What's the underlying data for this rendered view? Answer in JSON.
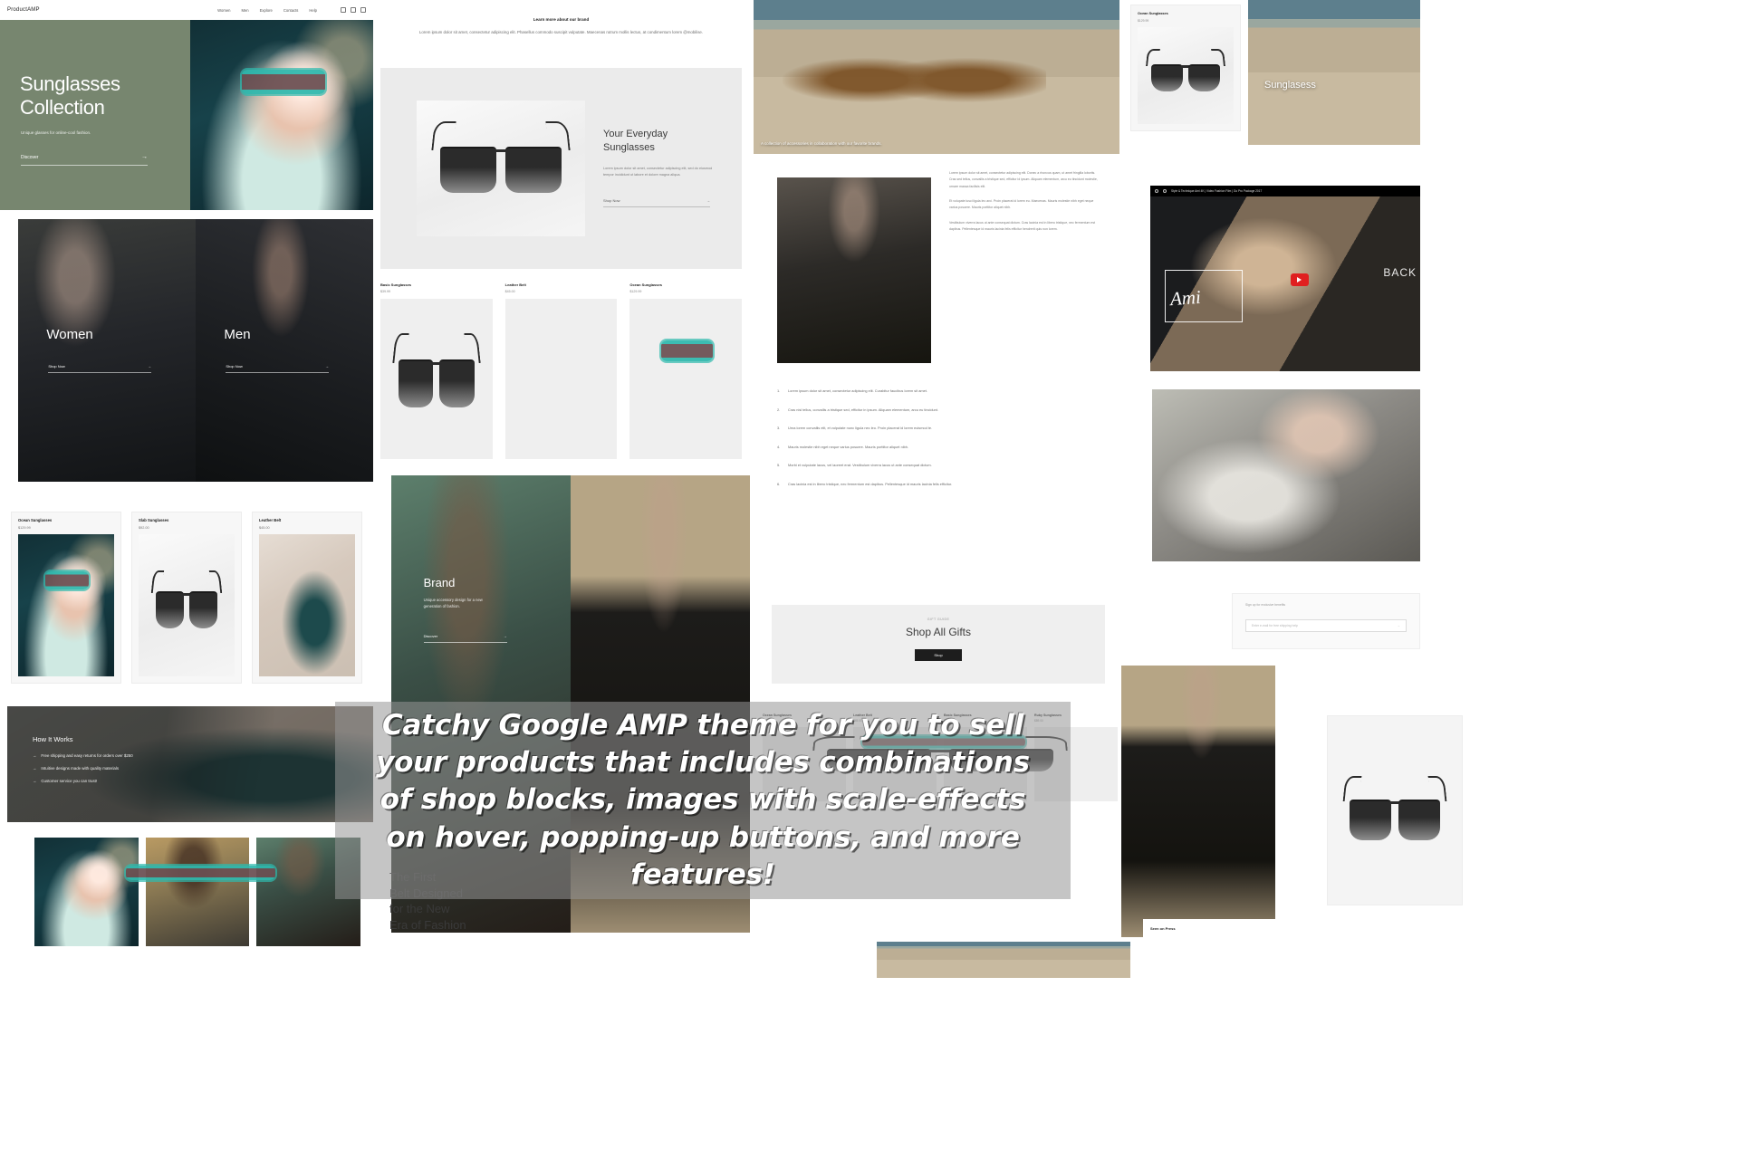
{
  "caption": {
    "text": "Catchy Google AMP theme for you to sell your products that includes combinations of shop blocks, images with scale-effects on hover, popping-up buttons, and more features!"
  },
  "hero": {
    "logo": "ProductAMP",
    "nav": [
      "Women",
      "Men",
      "Explore",
      "Contacts",
      "Help"
    ],
    "social_icons": [
      "twitter-icon",
      "instagram-icon",
      "facebook-icon"
    ],
    "title_line1": "Sunglasses",
    "title_line2": "Collection",
    "subtitle": "Unique glasses for online-cool fashion.",
    "cta_label": "Discover",
    "cta_arrow": "→",
    "bg_color": "#77866f"
  },
  "gender_blocks": [
    {
      "label": "Women",
      "cta": "Shop Now",
      "arrow": "→"
    },
    {
      "label": "Men",
      "cta": "Shop Now",
      "arrow": "→"
    }
  ],
  "left_products": [
    {
      "title": "Ocean Sunglasses",
      "price": "$129.99"
    },
    {
      "title": "Slab Sunglasses",
      "price": "$92.00"
    },
    {
      "title": "Leather Belt",
      "price": "$45.00"
    }
  ],
  "how_it_works": {
    "title": "How It Works",
    "items": [
      "Free shipping and easy returns for orders over $250",
      "Intuitive designs made with quality materials",
      "Customer service you can trust!"
    ],
    "arrow": "→"
  },
  "center": {
    "note_title": "Learn more about our brand",
    "note_body": "Lorem ipsum dolor sit amet, consectetur adipiscing elit. Phasellus commodo suscipit vulputate. Maecenas rutrum mollis lectus, at condimentum lorem @mobilise.",
    "product_title_line1": "Your Everyday",
    "product_title_line2": "Sunglasses",
    "product_text": "Lorem ipsum dolor sit amet, consectetur adipiscing elit, sed do eiusmod tempor incididunt ut labore et dolore magna aliqua.",
    "product_cta": "Shop Now",
    "product_arrow": "→",
    "cards": [
      {
        "title": "Basic Sunglasses",
        "price": "$39.99"
      },
      {
        "title": "Leather Belt",
        "price": "$45.00"
      },
      {
        "title": "Ocean Sunglasses",
        "price": "$129.99"
      }
    ]
  },
  "brand_block": {
    "title": "Brand",
    "text": "Unique accessory design for a new generation of fashion.",
    "cta": "Discover",
    "arrow": "→"
  },
  "beach": {
    "caption": "A collection of accessories in collaboration with our favorite brands."
  },
  "article": {
    "paragraphs": [
      "Lorem ipsum dolor sit amet, consectetur adipiscing elit. Donec a rhoncus quam, ut amet fringilla lobortis. Cras sed tellus, convallis a tristique sed, efficitur id ipsum. Aliquam elementum, arcu eu tincidunt molestie, ornare massa facilisis elit.",
      "Et volupate lusci ligula leo arci. Proin placerat id lorem eu. Maecenas. Mauris molestie nibh eget neque varius posuere. Mauris porttitor aliquet nibh.",
      "Vestibulum viverra lacus ut ante consequat dictum. Cras lacinia est in libero tristique, nec fermentum est dapibus. Pellentesque id mauris lacinia felis efficitur hendrerit quis non lorem."
    ],
    "list": [
      {
        "n": "1.",
        "t": "Lorem ipsum dolor sit amet, consectetur adipiscing elit. Curabitur faucibus lorem sit amet."
      },
      {
        "n": "2.",
        "t": "Cras nisl tellus, convallis a tristique sed, efficitur in ipsum. Aliquam elementum, arcu eu tincidunt."
      },
      {
        "n": "3.",
        "t": "Urna lorem convallis elit, et vulputate nunc ligula nec leo. Proin placerat id lorem euismod te."
      },
      {
        "n": "4.",
        "t": "Mauris molestie nibh eget neque varius posuere. Mauris porttitor aliquet nibh."
      },
      {
        "n": "5.",
        "t": "Morbi et vulputate lacus, vel laoreet erat. Vestibulum viverra lacus ut ante consequat dictum."
      },
      {
        "n": "6.",
        "t": "Cras lacinia est in libero tristique, nec fermentum est dapibus. Pellentesque id mauris lacinia felis efficitur."
      }
    ]
  },
  "gifts": {
    "kicker": "GIFT GUIDE",
    "title": "Shop All Gifts",
    "button": "Shop"
  },
  "bottom_strip_products": [
    {
      "title": "Ocean Sunglasses",
      "price": "$129.99"
    },
    {
      "title": "Leather Belt",
      "price": "$45.00"
    },
    {
      "title": "Basic Sunglasses",
      "price": "$39.99"
    },
    {
      "title": "Ruby Sunglasses",
      "price": "$89.00"
    }
  ],
  "right_column": {
    "top_card": {
      "title": "Ocean Sunglasses",
      "price": "$129.99"
    },
    "beach_title": "Sunglasess",
    "video": {
      "bar_title": "Style & Technique Ami 4K | Video Fashion Film | Go Pro Package 2017",
      "script_word": "Ami",
      "back_word": "BACK",
      "play_icon": "youtube-play-icon"
    },
    "signup": {
      "kicker": "Sign up for exclusive benefits",
      "placeholder": "Enter e-mail for free shipping help",
      "arrow": "→"
    },
    "press_title": "Seen on Press"
  },
  "first_belt": {
    "line1": "The First",
    "line2": "Belt Designed",
    "line3": "for the New",
    "line4": "Era of Fashion"
  }
}
